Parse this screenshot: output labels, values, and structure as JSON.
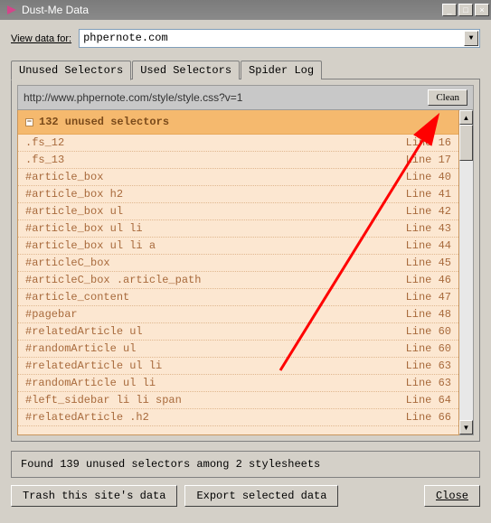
{
  "window": {
    "title": "Dust-Me Data"
  },
  "viewLabel": "View data for:",
  "domain": "phpernote.com",
  "tabs": [
    {
      "label": "Unused Selectors",
      "active": true
    },
    {
      "label": "Used Selectors",
      "active": false
    },
    {
      "label": "Spider Log",
      "active": false
    }
  ],
  "stylesheet": {
    "url": "http://www.phpernote.com/style/style.css?v=1",
    "cleanLabel": "Clean"
  },
  "group": {
    "count": "132 unused selectors"
  },
  "selectors": [
    {
      "sel": ".fs_12",
      "line": "Line 16"
    },
    {
      "sel": ".fs_13",
      "line": "Line 17"
    },
    {
      "sel": "#article_box",
      "line": "Line 40"
    },
    {
      "sel": "#article_box h2",
      "line": "Line 41"
    },
    {
      "sel": "#article_box ul",
      "line": "Line 42"
    },
    {
      "sel": "#article_box ul li",
      "line": "Line 43"
    },
    {
      "sel": "#article_box ul li a",
      "line": "Line 44"
    },
    {
      "sel": "#articleC_box",
      "line": "Line 45"
    },
    {
      "sel": "#articleC_box .article_path",
      "line": "Line 46"
    },
    {
      "sel": "#article_content",
      "line": "Line 47"
    },
    {
      "sel": "#pagebar",
      "line": "Line 48"
    },
    {
      "sel": "#relatedArticle ul",
      "line": "Line 60"
    },
    {
      "sel": "#randomArticle ul",
      "line": "Line 60"
    },
    {
      "sel": "#relatedArticle ul li",
      "line": "Line 63"
    },
    {
      "sel": "#randomArticle ul li",
      "line": "Line 63"
    },
    {
      "sel": "#left_sidebar li li span",
      "line": "Line 64"
    },
    {
      "sel": "#relatedArticle .h2",
      "line": "Line 66"
    }
  ],
  "status": "Found 139 unused selectors among 2 stylesheets",
  "buttons": {
    "trash": "Trash this site's data",
    "export": "Export selected data",
    "close": "Close"
  }
}
